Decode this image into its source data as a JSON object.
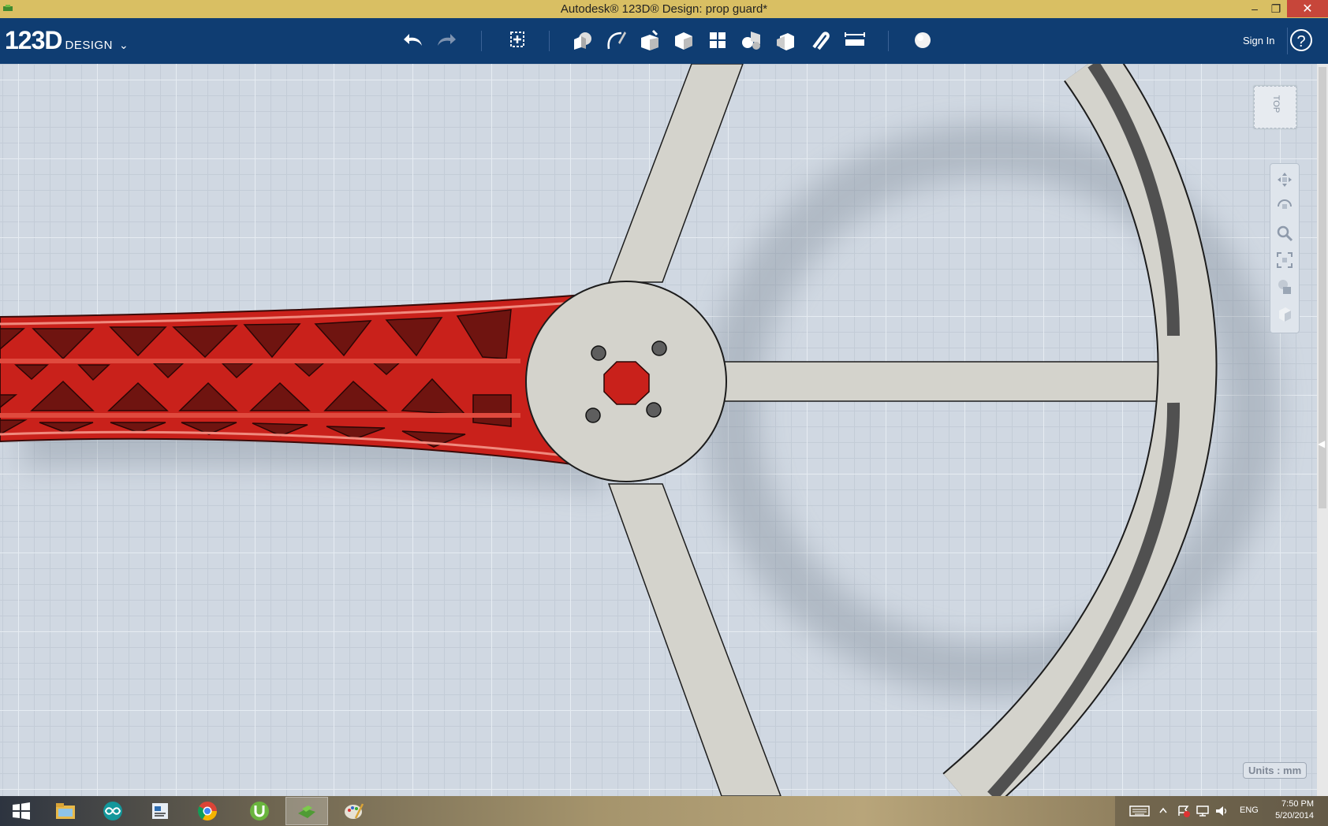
{
  "window": {
    "title": "Autodesk® 123D® Design: prop guard*",
    "minimize_glyph": "–",
    "maximize_glyph": "❐",
    "close_glyph": "✕"
  },
  "toolbar": {
    "logo_main": "123D",
    "logo_sub": "DESIGN",
    "logo_chevron": "⌄",
    "sign_in": "Sign In",
    "help": "?",
    "tools": [
      "undo-icon",
      "redo-icon",
      "transform-icon",
      "primitives-icon",
      "sketch-icon",
      "construct-icon",
      "modify-icon",
      "pattern-icon",
      "grouping-icon",
      "combine-icon",
      "snap-icon",
      "measure-icon",
      "material-icon"
    ]
  },
  "viewport": {
    "viewcube_label": "TOP",
    "units_label": "Units : mm",
    "nav_tools": [
      "pan-icon",
      "orbit-icon",
      "zoom-icon",
      "fit-icon",
      "visual-style-icon",
      "materials-outline-icon"
    ],
    "colors": {
      "arm": "#cc1f1a",
      "guard": "#d2d2cc",
      "background": "#d0d8e2"
    }
  },
  "taskbar": {
    "apps": [
      "windows-start-icon",
      "file-explorer-icon",
      "arduino-icon",
      "reader-icon",
      "chrome-icon",
      "utorrent-icon",
      "123d-design-icon",
      "paint-icon"
    ],
    "language": "ENG",
    "time": "7:50 PM",
    "date": "5/20/2014"
  }
}
